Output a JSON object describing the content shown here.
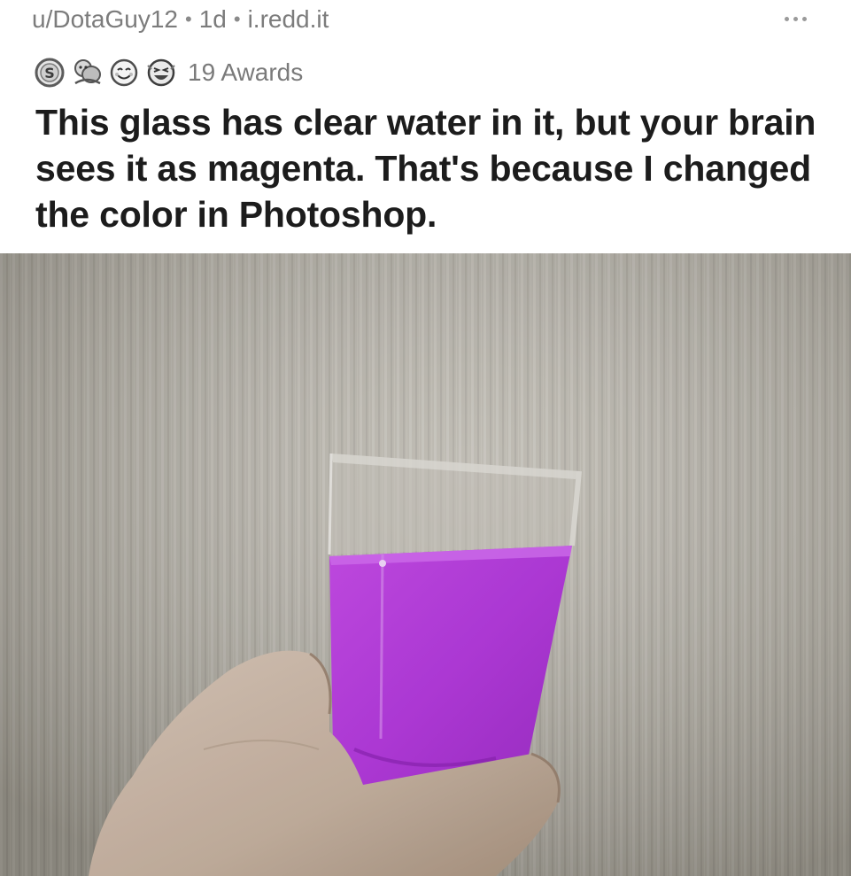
{
  "post": {
    "author": "u/DotaGuy12",
    "age": "1d",
    "domain": "i.redd.it",
    "separator": "•",
    "awards": {
      "count_label": "19 Awards",
      "icons": [
        "silver-award-icon",
        "hug-award-icon",
        "wholesome-award-icon",
        "laughing-award-icon"
      ]
    },
    "title": "This glass has clear water in it, but your brain sees it as magenta. That's because I changed the color in Photoshop."
  },
  "image": {
    "subject": "hand holding glass",
    "colors": {
      "liquid": "#b63cdc",
      "wall": "#b9b5ab",
      "skin": "#c9b6a6"
    }
  },
  "more_menu": {
    "icon": "more-options-icon"
  }
}
